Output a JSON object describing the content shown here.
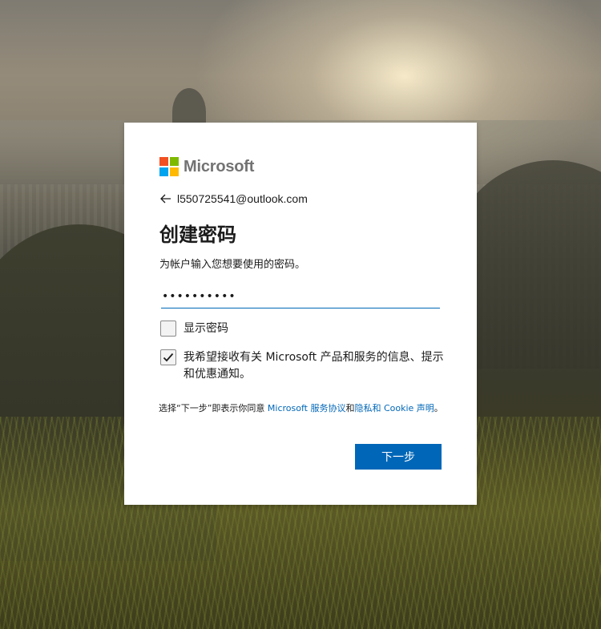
{
  "brand": {
    "name": "Microsoft",
    "logo_colors": [
      "#f25022",
      "#7fba00",
      "#00a4ef",
      "#ffb900"
    ]
  },
  "identity": {
    "back_icon": "arrow-left-icon",
    "email": "l550725541@outlook.com"
  },
  "page": {
    "title": "创建密码",
    "description": "为帐户输入您想要使用的密码。"
  },
  "password": {
    "value": "••••••••••",
    "type": "password"
  },
  "options": {
    "show_password_label": "显示密码",
    "show_password_checked": false,
    "marketing_label": "我希望接收有关 Microsoft 产品和服务的信息、提示和优惠通知。",
    "marketing_checked": true
  },
  "terms": {
    "prefix": "选择“下一步”即表示你同意 ",
    "service_link": "Microsoft 服务协议",
    "conjunction": "和",
    "privacy_link": "隐私和 Cookie 声明",
    "suffix": "。"
  },
  "actions": {
    "next_label": "下一步"
  },
  "colors": {
    "accent": "#0067b8",
    "card_bg": "#ffffff",
    "text": "#1b1b1b"
  }
}
